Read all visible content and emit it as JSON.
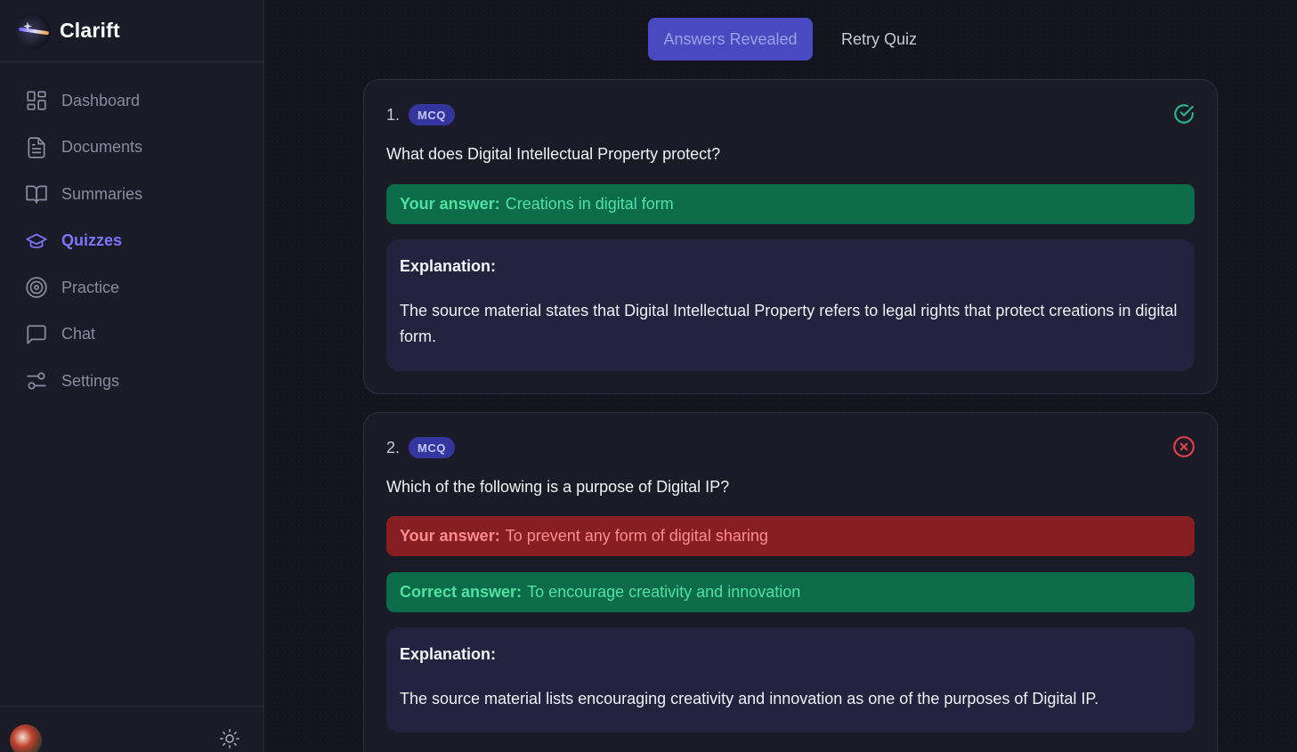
{
  "app": {
    "name": "Clarift"
  },
  "sidebar": {
    "items": [
      {
        "label": "Dashboard",
        "icon": "dashboard-icon",
        "active": false
      },
      {
        "label": "Documents",
        "icon": "document-icon",
        "active": false
      },
      {
        "label": "Summaries",
        "icon": "book-icon",
        "active": false
      },
      {
        "label": "Quizzes",
        "icon": "graduation-cap-icon",
        "active": true
      },
      {
        "label": "Practice",
        "icon": "target-icon",
        "active": false
      },
      {
        "label": "Chat",
        "icon": "chat-icon",
        "active": false
      },
      {
        "label": "Settings",
        "icon": "sliders-icon",
        "active": false
      }
    ]
  },
  "toolbar": {
    "revealed_label": "Answers Revealed",
    "retry_label": "Retry Quiz"
  },
  "colors": {
    "accent": "#7b74ff",
    "correct": "#0c6b48",
    "incorrect": "#871f22"
  },
  "questions": [
    {
      "number": "1.",
      "type": "MCQ",
      "status": "correct",
      "status_icon": "check-circle-icon",
      "text": "What does Digital Intellectual Property protect?",
      "your_answer_label": "Your answer:",
      "your_answer": "Creations in digital form",
      "explanation_title": "Explanation:",
      "explanation": "The source material states that Digital Intellectual Property refers to legal rights that protect creations in digital form."
    },
    {
      "number": "2.",
      "type": "MCQ",
      "status": "incorrect",
      "status_icon": "x-circle-icon",
      "text": "Which of the following is a purpose of Digital IP?",
      "your_answer_label": "Your answer:",
      "your_answer": "To prevent any form of digital sharing",
      "correct_answer_label": "Correct answer:",
      "correct_answer": "To encourage creativity and innovation",
      "explanation_title": "Explanation:",
      "explanation": "The source material lists encouraging creativity and innovation as one of the purposes of Digital IP."
    }
  ]
}
